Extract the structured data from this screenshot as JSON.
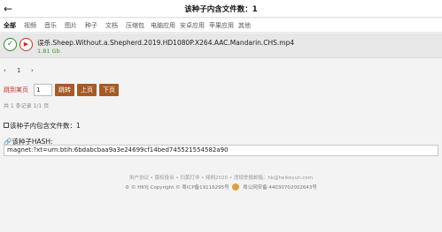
{
  "header": {
    "title": "该种子内含文件数：1"
  },
  "categories": [
    {
      "label": "全部",
      "active": true
    },
    {
      "label": "视频"
    },
    {
      "label": "音乐"
    },
    {
      "label": "图片"
    },
    {
      "label": "种子"
    },
    {
      "label": "文档"
    },
    {
      "label": "压缩包"
    },
    {
      "label": "电脑应用"
    },
    {
      "label": "安卓应用"
    },
    {
      "label": "苹果应用"
    },
    {
      "label": "其他"
    }
  ],
  "file": {
    "name": "误杀.Sheep.Without.a.Shepherd.2019.HD1080P.X264.AAC.Mandarin.CHS.mp4",
    "size": "1.81 Gb"
  },
  "pagination": {
    "prev": "‹",
    "page": "1",
    "next": "›"
  },
  "jump": {
    "label": "跳到某页",
    "value": "1",
    "go_label": "跳转",
    "prev_label": "上页",
    "next_label": "下页"
  },
  "meta": "共 1 条记录 1/1 页",
  "file_count": "该种子内包含文件数：1",
  "hash": {
    "label": "该种子HASH:",
    "value": "magnet:?xt=urn:btih:6bdabcbaa9a3e24699cf14bed745521554582a90"
  },
  "footer": {
    "links": "用户协议 • 版权投诉 • 扫黄打非 • 绿网2020 • 违规举报邮箱：hk@heikeyun.com",
    "copyright": "© HKYJ Copyright ©",
    "icp": "粤ICP备19116295号",
    "police": "粤公网安备 44030702002643号"
  }
}
